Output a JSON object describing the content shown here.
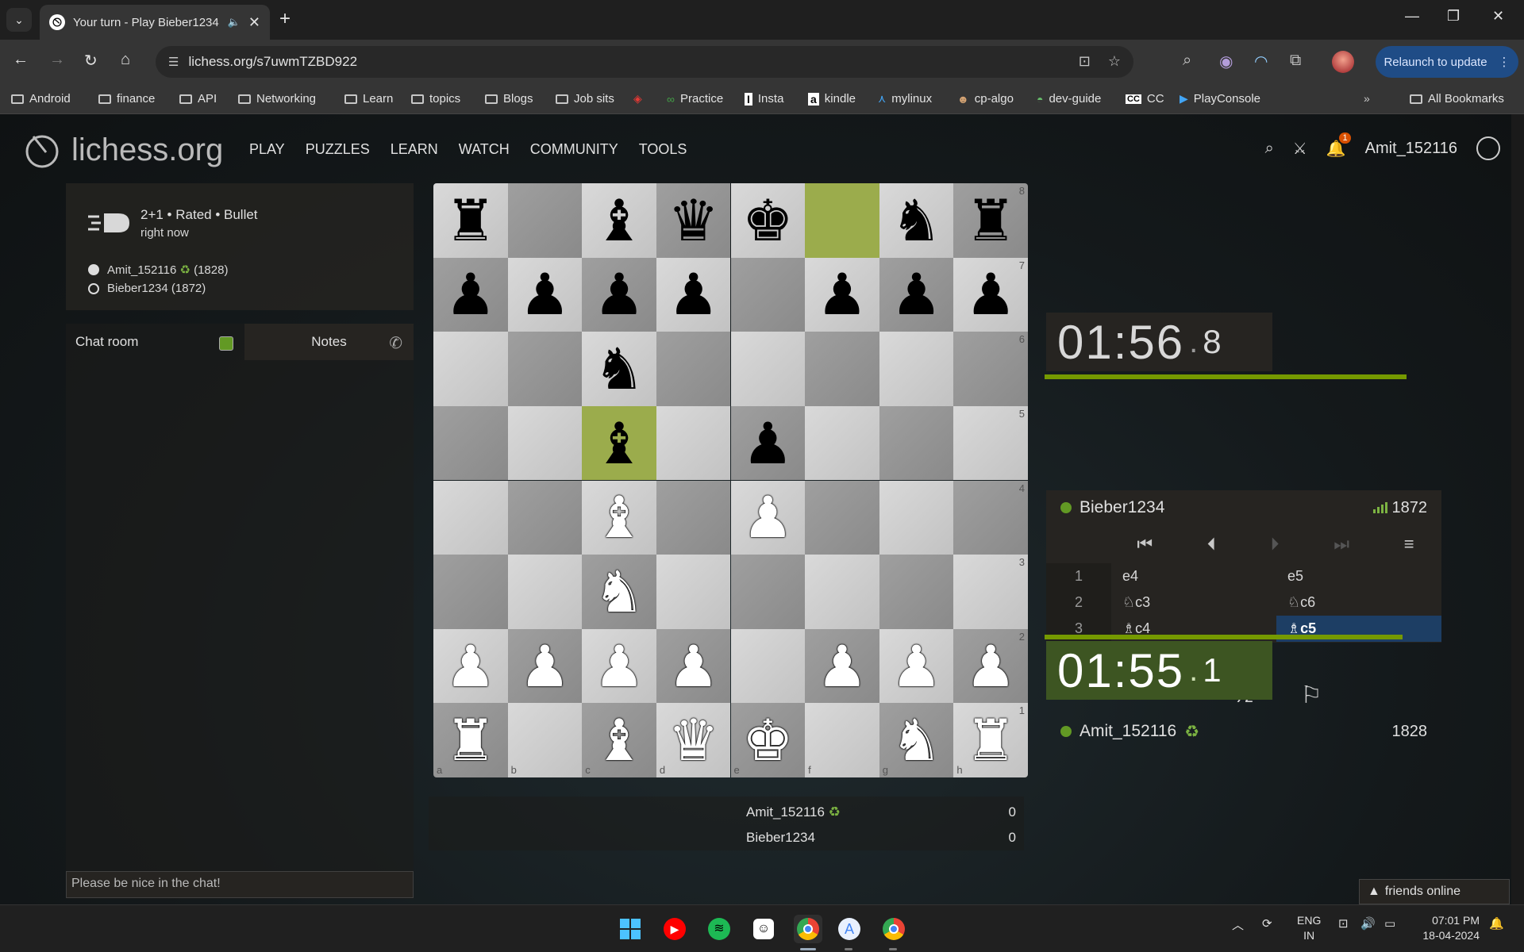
{
  "browser": {
    "tab_title": "Your turn - Play Bieber1234",
    "url": "lichess.org/s7uwmTZBD922",
    "relaunch_label": "Relaunch to update",
    "bookmarks": [
      "Android",
      "finance",
      "API",
      "Networking",
      "Learn",
      "topics",
      "Blogs",
      "Job sits",
      "Practice",
      "Insta",
      "kindle",
      "mylinux",
      "cp-algo",
      "dev-guide",
      "CC",
      "PlayConsole"
    ],
    "all_bookmarks": "All Bookmarks",
    "cc_badge": "CC",
    "insta_badge": "I",
    "kindle_badge": "a"
  },
  "site": {
    "logo_text": "lichess.org",
    "nav": [
      "PLAY",
      "PUZZLES",
      "LEARN",
      "WATCH",
      "COMMUNITY",
      "TOOLS"
    ],
    "notification_count": "1",
    "username": "Amit_152116"
  },
  "game": {
    "title": "2+1 • Rated • Bullet",
    "time": "right now",
    "white": "Amit_152116",
    "white_rating": "(1828)",
    "black": "Bieber1234 (1872)"
  },
  "chat": {
    "tab_chat": "Chat room",
    "tab_notes": "Notes",
    "placeholder": "Please be nice in the chat!"
  },
  "board": {
    "files": [
      "a",
      "b",
      "c",
      "d",
      "e",
      "f",
      "g",
      "h"
    ],
    "ranks": [
      "8",
      "7",
      "6",
      "5",
      "4",
      "3",
      "2",
      "1"
    ],
    "position": [
      [
        "r",
        "",
        "b",
        "q",
        "k",
        "",
        "n",
        "r"
      ],
      [
        "p",
        "p",
        "p",
        "p",
        "",
        "p",
        "p",
        "p"
      ],
      [
        "",
        "",
        "n",
        "",
        "",
        "",
        "",
        ""
      ],
      [
        "",
        "",
        "b",
        "",
        "p",
        "",
        "",
        ""
      ],
      [
        "",
        "",
        "B",
        "",
        "P",
        "",
        "",
        ""
      ],
      [
        "",
        "",
        "N",
        "",
        "",
        "",
        "",
        ""
      ],
      [
        "P",
        "P",
        "P",
        "P",
        "",
        "P",
        "P",
        "P"
      ],
      [
        "R",
        "",
        "B",
        "Q",
        "K",
        "",
        "N",
        "R"
      ]
    ],
    "highlights": [
      "f8",
      "c5"
    ]
  },
  "score": {
    "rows": [
      {
        "name": "Amit_152116",
        "value": "0"
      },
      {
        "name": "Bieber1234",
        "value": "0"
      }
    ]
  },
  "opponent": {
    "clock_main": "01:56",
    "clock_tenths": "8",
    "name": "Bieber1234",
    "rating": "1872",
    "time_remaining_fraction": 0.97
  },
  "player": {
    "clock_main": "01:55",
    "clock_tenths": "1",
    "name": "Amit_152116",
    "rating": "1828",
    "time_remaining_fraction": 0.96
  },
  "moves": [
    {
      "num": "1",
      "white": "e4",
      "black": "e5"
    },
    {
      "num": "2",
      "white": "♘c3",
      "black": "♘c6"
    },
    {
      "num": "3",
      "white": "♗c4",
      "black": "♗c5"
    }
  ],
  "draw_label": "½",
  "friends": "friends online",
  "taskbar": {
    "lang_1": "ENG",
    "lang_2": "IN",
    "time": "07:01 PM",
    "date": "18-04-2024"
  }
}
